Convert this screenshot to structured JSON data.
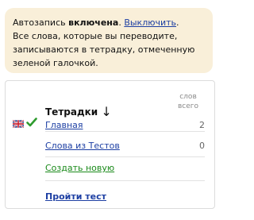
{
  "notice": {
    "prefix": "Автозапись ",
    "status_bold": "включена",
    "sep": ". ",
    "disable_link": "Выключить",
    "end": ".",
    "text": "Все слова, которые вы переводите, записываются в тетрадку, отмеченную зеленой галочкой."
  },
  "table": {
    "header": "Тетрадки",
    "sort_arrow": "↓",
    "col_header": [
      "слов",
      "всего"
    ],
    "rows": [
      {
        "label": "Главная",
        "count": "2",
        "active": true
      },
      {
        "label": "Слова из Тестов",
        "count": "0",
        "active": false
      }
    ],
    "create_label": "Создать новую",
    "test_label": "Пройти тест"
  },
  "icons": {
    "flag": "uk-flag-icon",
    "check": "green-check-icon"
  },
  "colors": {
    "link": "#1d3fa3",
    "create": "#1a8a1a",
    "check": "#2e9b2e",
    "notice_bg": "#f9efd9"
  }
}
